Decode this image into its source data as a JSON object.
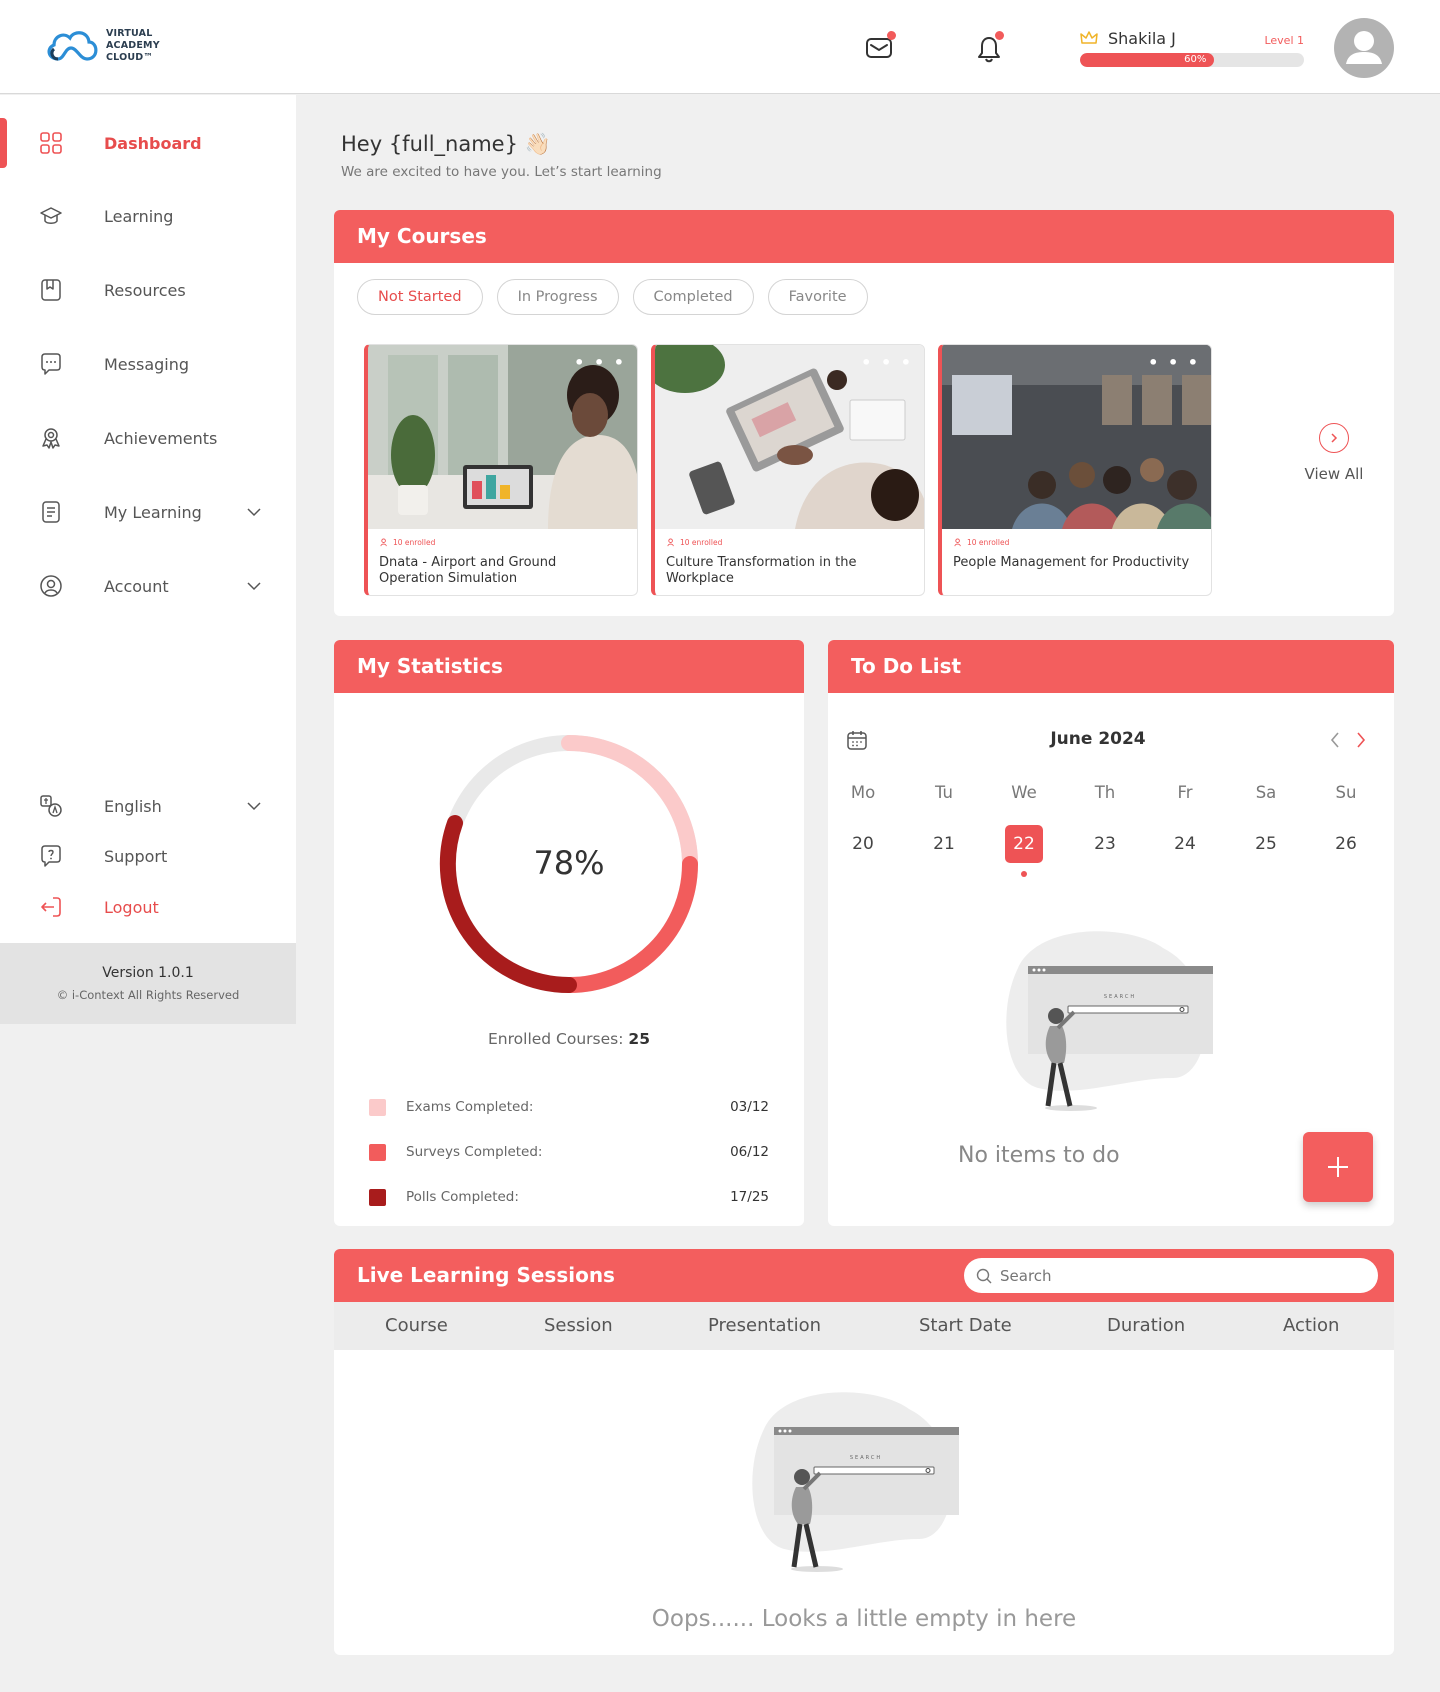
{
  "brand": {
    "name_lines": [
      "VIRTUAL",
      "ACADEMY",
      "CLOUD™"
    ],
    "accent": "#ee5355",
    "logo_blue": "#2c8ed6"
  },
  "header": {
    "user_name": "Shakila J",
    "level": "Level 1",
    "progress_label": "60%",
    "progress": 0.6
  },
  "sidebar": {
    "items": [
      {
        "label": "Dashboard",
        "icon": "grid-icon"
      },
      {
        "label": "Learning",
        "icon": "graduation-cap-icon"
      },
      {
        "label": "Resources",
        "icon": "book-icon"
      },
      {
        "label": "Messaging",
        "icon": "chat-icon"
      },
      {
        "label": "Achievements",
        "icon": "award-icon"
      },
      {
        "label": "My Learning",
        "icon": "notebook-icon"
      },
      {
        "label": "Account",
        "icon": "user-circle-icon"
      }
    ],
    "bottom_items": [
      {
        "label": "English",
        "icon": "translate-icon"
      },
      {
        "label": "Support",
        "icon": "help-chat-icon"
      },
      {
        "label": "Logout",
        "icon": "logout-icon"
      }
    ],
    "version": "Version 1.0.1",
    "copyright": "© i-Context All Rights Reserved"
  },
  "greeting": {
    "title": "Hey {full_name} 👋🏻",
    "subtitle": "We are excited to have you. Let’s start learning"
  },
  "courses": {
    "title": "My Courses",
    "filters": [
      "Not Started",
      "In Progress",
      "Completed",
      "Favorite"
    ],
    "cards": [
      {
        "enrolled": "10 enrolled",
        "title": "Dnata - Airport and Ground Operation Simulation"
      },
      {
        "enrolled": "10 enrolled",
        "title": "Culture Transformation in the Workplace"
      },
      {
        "enrolled": "10 enrolled",
        "title": "People Management for Productivity"
      }
    ],
    "view_all": "View All"
  },
  "statistics": {
    "title": "My Statistics",
    "percent": "78%",
    "enrolled_label": "Enrolled Courses:",
    "enrolled_value": "25",
    "legend": [
      {
        "label": "Exams Completed:",
        "value": "03/12",
        "color": "#fbcaca"
      },
      {
        "label": "Surveys Completed:",
        "value": "06/12",
        "color": "#f25c5c"
      },
      {
        "label": "Polls Completed:",
        "value": "17/25",
        "color": "#a81c1c"
      }
    ]
  },
  "todo": {
    "title": "To Do List",
    "month": "June 2024",
    "days": [
      "Mo",
      "Tu",
      "We",
      "Th",
      "Fr",
      "Sa",
      "Su"
    ],
    "dates": [
      "20",
      "21",
      "22",
      "23",
      "24",
      "25",
      "26"
    ],
    "selected": "22",
    "empty": "No items to do",
    "illustration_word": "SEARCH"
  },
  "live": {
    "title": "Live Learning Sessions",
    "search_placeholder": "Search",
    "columns": [
      "Course",
      "Session",
      "Presentation",
      "Start Date",
      "Duration",
      "Action"
    ],
    "empty": "Oops...... Looks a little empty in here"
  }
}
